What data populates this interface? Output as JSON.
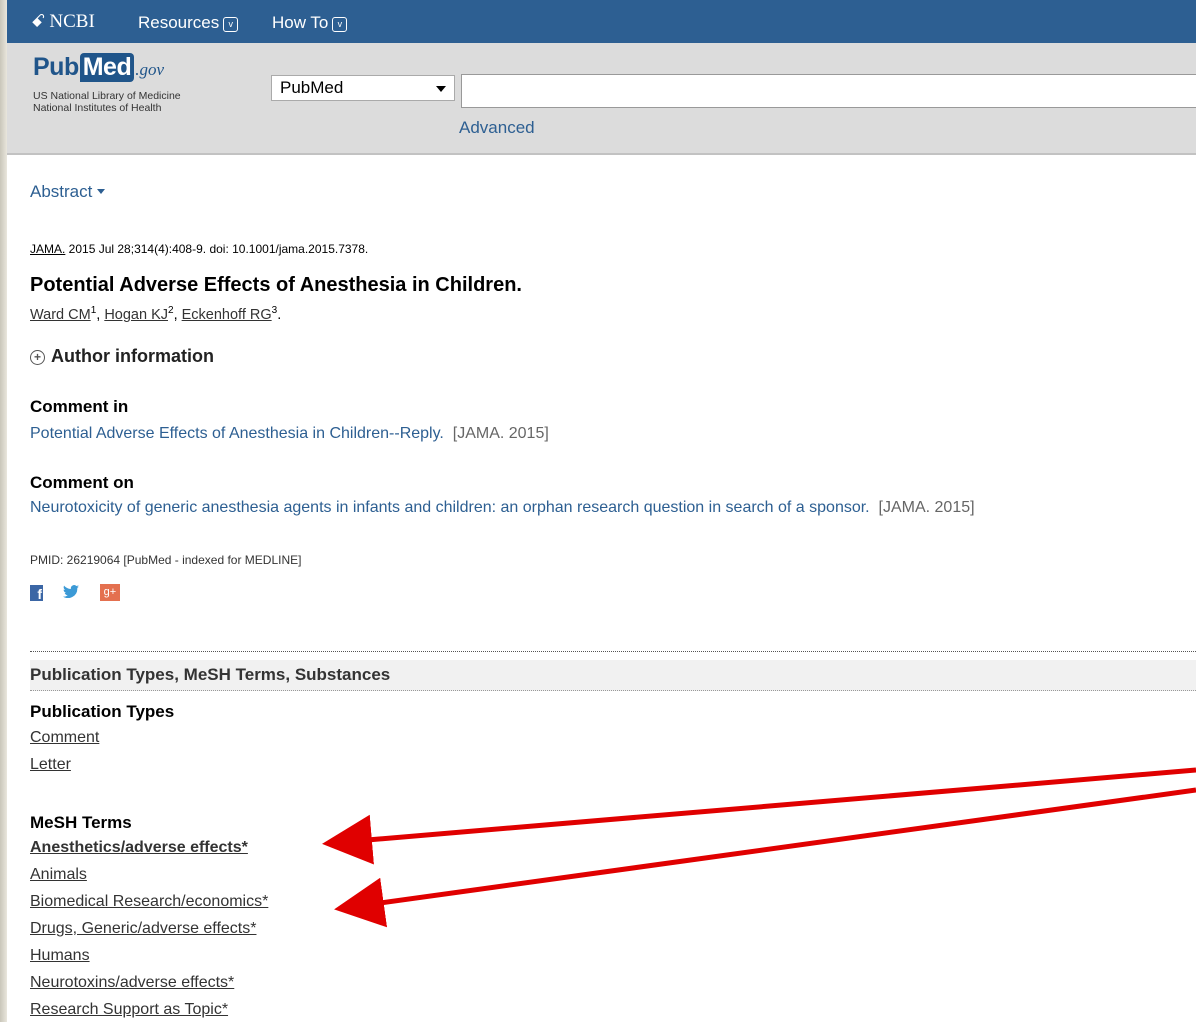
{
  "ncbi_bar": {
    "logo": "NCBI",
    "resources": "Resources",
    "howto": "How To"
  },
  "header": {
    "logo_pub": "Pub",
    "logo_med": "Med",
    "logo_gov": ".gov",
    "sub1": "US National Library of Medicine",
    "sub2": "National Institutes of Health",
    "db_selected": "PubMed",
    "search_value": "",
    "advanced": "Advanced"
  },
  "article": {
    "format": "Abstract",
    "journal": "JAMA.",
    "citation": " 2015 Jul 28;314(4):408-9. doi: 10.1001/jama.2015.7378.",
    "title": "Potential Adverse Effects of Anesthesia in Children.",
    "authors": [
      {
        "name": "Ward CM",
        "sup": "1"
      },
      {
        "name": "Hogan KJ",
        "sup": "2"
      },
      {
        "name": "Eckenhoff RG",
        "sup": "3"
      }
    ],
    "author_info": "Author information",
    "comment_in_head": "Comment in",
    "comment_in_link": "Potential Adverse Effects of Anesthesia in Children--Reply.",
    "comment_in_src": "[JAMA. 2015]",
    "comment_on_head": "Comment on",
    "comment_on_link": "Neurotoxicity of generic anesthesia agents in infants and children: an orphan research question in search of a sponsor.",
    "comment_on_src": "[JAMA. 2015]",
    "pmid": "PMID: 26219064 [PubMed - indexed for MEDLINE]"
  },
  "share": {
    "facebook": "f",
    "twitter": "❛",
    "googleplus": "g+"
  },
  "details": {
    "section_title": "Publication Types, MeSH Terms, Substances",
    "pub_types_head": "Publication Types",
    "pub_types": [
      "Comment",
      "Letter"
    ],
    "mesh_head": "MeSH Terms",
    "mesh_terms": [
      "Anesthetics/adverse effects*",
      "Animals",
      "Biomedical Research/economics*",
      "Drugs, Generic/adverse effects*",
      "Humans",
      "Neurotoxins/adverse effects*",
      "Research Support as Topic*"
    ]
  },
  "annotation_color": "#e00000"
}
